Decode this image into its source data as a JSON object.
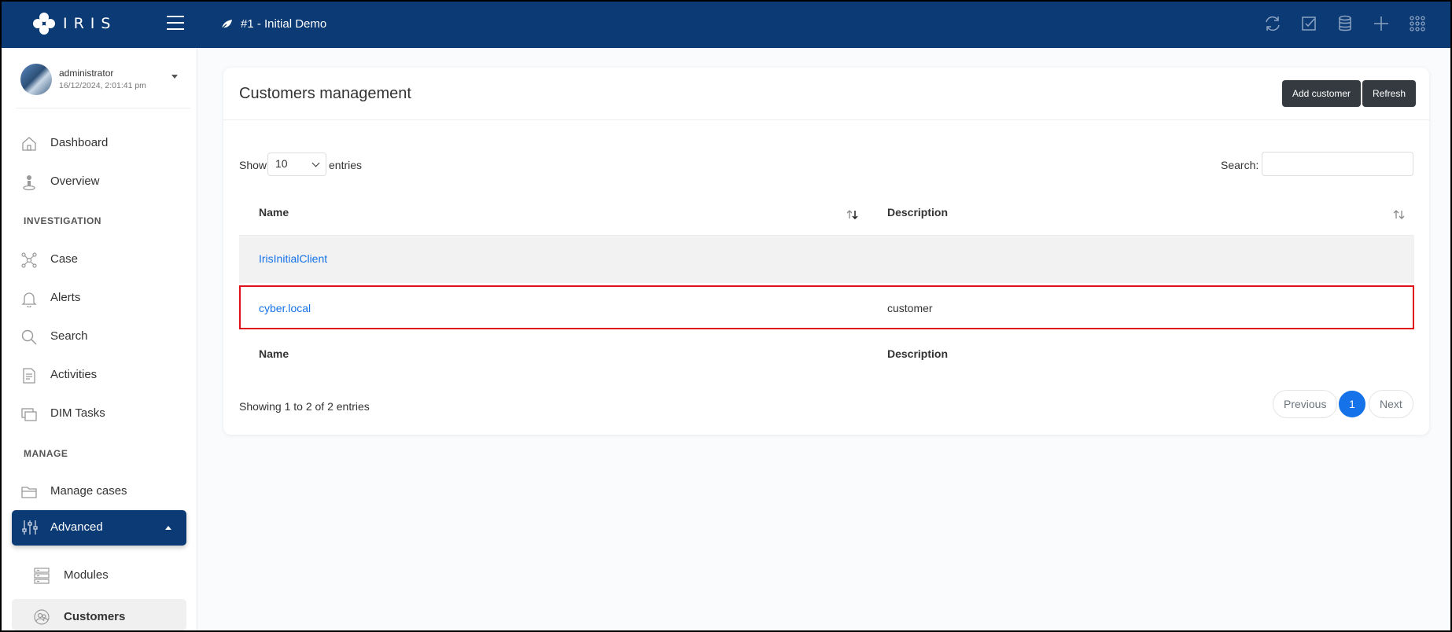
{
  "topbar": {
    "logo_text": "IRIS",
    "case_title": "#1 - Initial Demo",
    "icons": [
      "refresh-icon",
      "checkbox-icon",
      "database-icon",
      "plus-icon",
      "grid-icon"
    ]
  },
  "user": {
    "name": "administrator",
    "datetime": "16/12/2024, 2:01:41 pm"
  },
  "sidebar": {
    "items": [
      {
        "label": "Dashboard",
        "icon": "home-icon"
      },
      {
        "label": "Overview",
        "icon": "person-icon"
      }
    ],
    "investigation_heading": "INVESTIGATION",
    "investigation_items": [
      {
        "label": "Case",
        "icon": "network-icon"
      },
      {
        "label": "Alerts",
        "icon": "bell-icon"
      },
      {
        "label": "Search",
        "icon": "search-icon"
      },
      {
        "label": "Activities",
        "icon": "document-icon"
      },
      {
        "label": "DIM Tasks",
        "icon": "windows-icon"
      }
    ],
    "manage_heading": "MANAGE",
    "manage_items": [
      {
        "label": "Manage cases",
        "icon": "folder-icon"
      }
    ],
    "advanced": {
      "label": "Advanced",
      "icon": "sliders-icon"
    },
    "sub_items": [
      {
        "label": "Modules",
        "icon": "server-icon"
      },
      {
        "label": "Customers",
        "icon": "customers-icon"
      }
    ]
  },
  "card": {
    "title": "Customers management",
    "add_button": "Add customer",
    "refresh_button": "Refresh",
    "show_label": "Show",
    "page_length": "10",
    "entries_label": "entries",
    "search_label": "Search:",
    "search_value": "",
    "columns": [
      "Name",
      "Description"
    ],
    "rows": [
      {
        "name": "IrisInitialClient",
        "description": ""
      },
      {
        "name": "cyber.local",
        "description": "customer"
      }
    ],
    "info": "Showing 1 to 2 of 2 entries",
    "pagination": {
      "previous": "Previous",
      "current": "1",
      "next": "Next"
    }
  },
  "colors": {
    "topbar": "#0b3a75",
    "link": "#1572e8",
    "highlight_border": "#e0101b",
    "button_dark": "#343a40"
  }
}
